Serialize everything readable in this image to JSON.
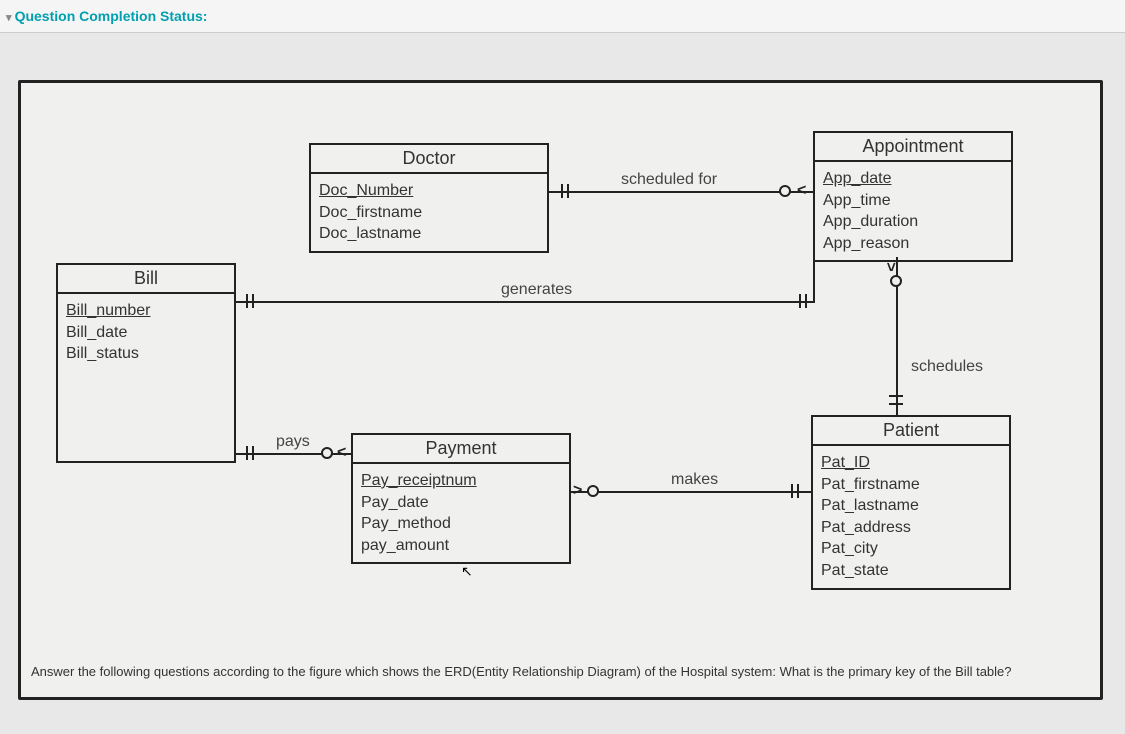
{
  "header": {
    "title": "Question Completion Status:"
  },
  "entities": {
    "doctor": {
      "title": "Doctor",
      "attrs": [
        "Doc_Number",
        "Doc_firstname",
        "Doc_lastname"
      ],
      "pk_index": 0
    },
    "appointment": {
      "title": "Appointment",
      "attrs": [
        "App_date",
        "App_time",
        "App_duration",
        "App_reason"
      ],
      "pk_index": 0
    },
    "bill": {
      "title": "Bill",
      "attrs": [
        "Bill_number",
        "Bill_date",
        "Bill_status"
      ],
      "pk_index": 0
    },
    "payment": {
      "title": "Payment",
      "attrs": [
        "Pay_receiptnum",
        "Pay_date",
        "Pay_method",
        "pay_amount"
      ],
      "pk_index": 0
    },
    "patient": {
      "title": "Patient",
      "attrs": [
        "Pat_ID",
        "Pat_firstname",
        "Pat_lastname",
        "Pat_address",
        "Pat_city",
        "Pat_state"
      ],
      "pk_index": 0
    }
  },
  "relationships": {
    "scheduled_for": "scheduled for",
    "generates": "generates",
    "pays": "pays",
    "makes": "makes",
    "schedules": "schedules"
  },
  "question": "Answer the following questions according to the figure which shows the ERD(Entity Relationship Diagram) of the Hospital system: What is the primary key of the Bill table?"
}
